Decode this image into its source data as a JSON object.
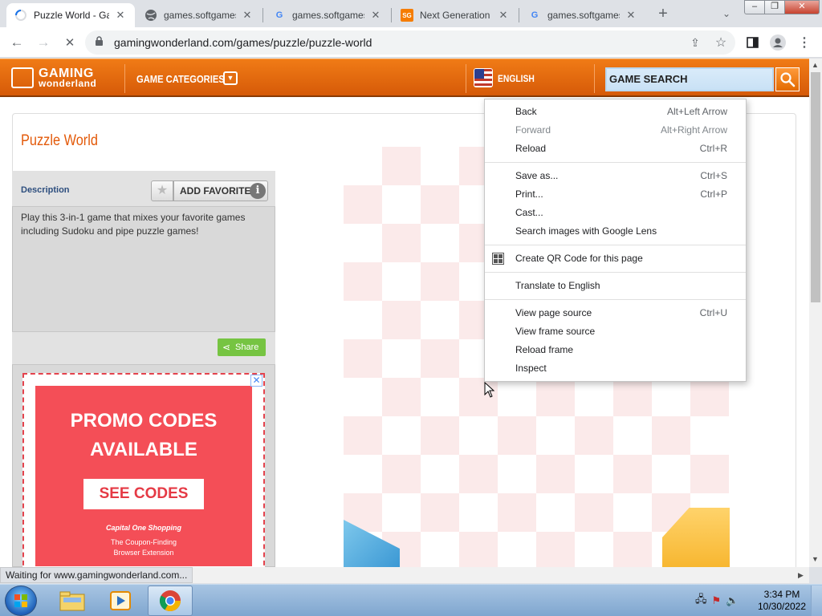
{
  "browser": {
    "tabs": [
      {
        "title": "Puzzle World - Ga",
        "favicon": "loading-spinner",
        "active": true
      },
      {
        "title": "games.softgames",
        "favicon": "globe-icon",
        "active": false
      },
      {
        "title": "games.softgames",
        "favicon": "google-icon",
        "active": false
      },
      {
        "title": "Next Generation I",
        "favicon": "sg-icon",
        "favicon_text": "SG",
        "active": false
      },
      {
        "title": "games.softgames",
        "favicon": "google-icon",
        "active": false
      }
    ],
    "new_tab": "+",
    "url": "gamingwonderland.com/games/puzzle/puzzle-world",
    "status": "Waiting for www.gamingwonderland.com..."
  },
  "site": {
    "logo_line1": "GAMING",
    "logo_line2": "wonderland",
    "nav_categories": "GAME CATEGORIES",
    "language": "ENGLISH",
    "search_placeholder": "GAME SEARCH",
    "game_title": "Puzzle World",
    "description_label": "Description",
    "favorite_label": "ADD FAVORITE",
    "description_text": "Play this 3-in-1 game that mixes your favorite games including Sudoku and pipe puzzle games!",
    "share_label": "Share",
    "ad": {
      "headline_1": "PROMO CODES",
      "headline_2": "AVAILABLE",
      "cta": "SEE CODES",
      "brand": "Capital One Shopping",
      "sub_1": "The Coupon-Finding",
      "sub_2": "Browser Extension"
    }
  },
  "context_menu": {
    "groups": [
      [
        {
          "label": "Back",
          "shortcut": "Alt+Left Arrow",
          "enabled": true
        },
        {
          "label": "Forward",
          "shortcut": "Alt+Right Arrow",
          "enabled": false
        },
        {
          "label": "Reload",
          "shortcut": "Ctrl+R",
          "enabled": true
        }
      ],
      [
        {
          "label": "Save as...",
          "shortcut": "Ctrl+S",
          "enabled": true
        },
        {
          "label": "Print...",
          "shortcut": "Ctrl+P",
          "enabled": true
        },
        {
          "label": "Cast...",
          "shortcut": "",
          "enabled": true
        },
        {
          "label": "Search images with Google Lens",
          "shortcut": "",
          "enabled": true
        }
      ],
      [
        {
          "label": "Create QR Code for this page",
          "shortcut": "",
          "enabled": true,
          "icon": "qr-code-icon"
        }
      ],
      [
        {
          "label": "Translate to English",
          "shortcut": "",
          "enabled": true
        }
      ],
      [
        {
          "label": "View page source",
          "shortcut": "Ctrl+U",
          "enabled": true
        },
        {
          "label": "View frame source",
          "shortcut": "",
          "enabled": true
        },
        {
          "label": "Reload frame",
          "shortcut": "",
          "enabled": true
        },
        {
          "label": "Inspect",
          "shortcut": "",
          "enabled": true
        }
      ]
    ]
  },
  "taskbar": {
    "time": "3:34 PM",
    "date": "10/30/2022",
    "apps": [
      "file-explorer-icon",
      "media-player-icon",
      "chrome-icon"
    ]
  },
  "colors": {
    "site_orange": "#e8690d",
    "title_orange": "#e35a0a",
    "ad_red": "#f44e57",
    "share_green": "#76c442"
  }
}
